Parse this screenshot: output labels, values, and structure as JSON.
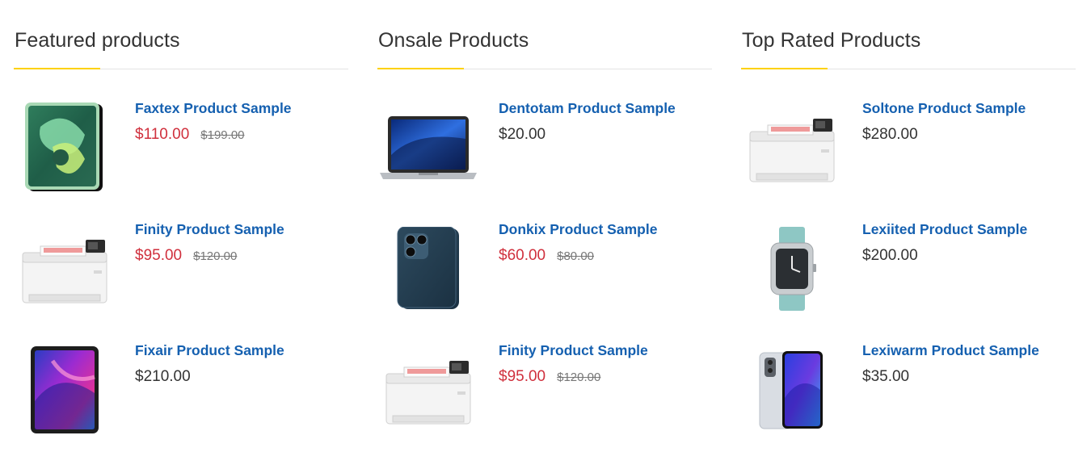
{
  "colors": {
    "accent": "#fdd100",
    "link": "#1560b0",
    "sale_price": "#d0303d",
    "regular_price": "#333333",
    "old_price": "#777777"
  },
  "columns": [
    {
      "title": "Featured products",
      "products": [
        {
          "name": "Faxtex Product Sample",
          "price": "$110.00",
          "old_price": "$199.00",
          "on_sale": true,
          "image": "tablet-green-image"
        },
        {
          "name": "Finity Product Sample",
          "price": "$95.00",
          "old_price": "$120.00",
          "on_sale": true,
          "image": "printer-image"
        },
        {
          "name": "Fixair Product Sample",
          "price": "$210.00",
          "old_price": "",
          "on_sale": false,
          "image": "tablet-colorful-image"
        }
      ]
    },
    {
      "title": "Onsale Products",
      "products": [
        {
          "name": "Dentotam Product Sample",
          "price": "$20.00",
          "old_price": "",
          "on_sale": false,
          "image": "laptop-image"
        },
        {
          "name": "Donkix Product Sample",
          "price": "$60.00",
          "old_price": "$80.00",
          "on_sale": true,
          "image": "smartphone-blue-image"
        },
        {
          "name": "Finity Product Sample",
          "price": "$95.00",
          "old_price": "$120.00",
          "on_sale": true,
          "image": "printer-image"
        }
      ]
    },
    {
      "title": "Top Rated Products",
      "products": [
        {
          "name": "Soltone Product Sample",
          "price": "$280.00",
          "old_price": "",
          "on_sale": false,
          "image": "printer-image"
        },
        {
          "name": "Lexiited Product Sample",
          "price": "$200.00",
          "old_price": "",
          "on_sale": false,
          "image": "smartwatch-image"
        },
        {
          "name": "Lexiwarm Product Sample",
          "price": "$35.00",
          "old_price": "",
          "on_sale": false,
          "image": "smartphone-purple-image"
        }
      ]
    }
  ]
}
